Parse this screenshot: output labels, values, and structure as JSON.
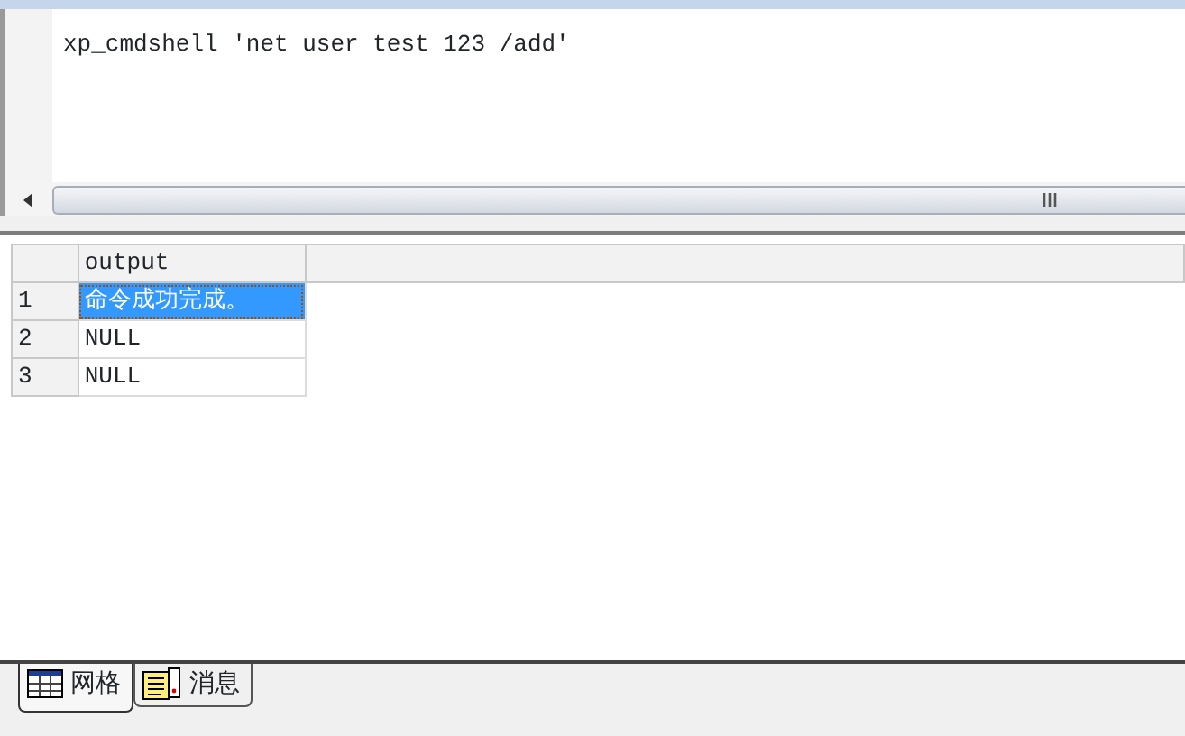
{
  "editor": {
    "query": "xp_cmdshell 'net user test 123 /add'"
  },
  "results": {
    "columns": [
      "output"
    ],
    "rows": [
      {
        "number": "1",
        "value": "命令成功完成。",
        "selected": true
      },
      {
        "number": "2",
        "value": "NULL",
        "selected": false
      },
      {
        "number": "3",
        "value": "NULL",
        "selected": false
      }
    ]
  },
  "tabs": [
    {
      "label": "网格",
      "kind": "grid",
      "selected": true
    },
    {
      "label": "消息",
      "kind": "messages",
      "selected": false
    }
  ]
}
